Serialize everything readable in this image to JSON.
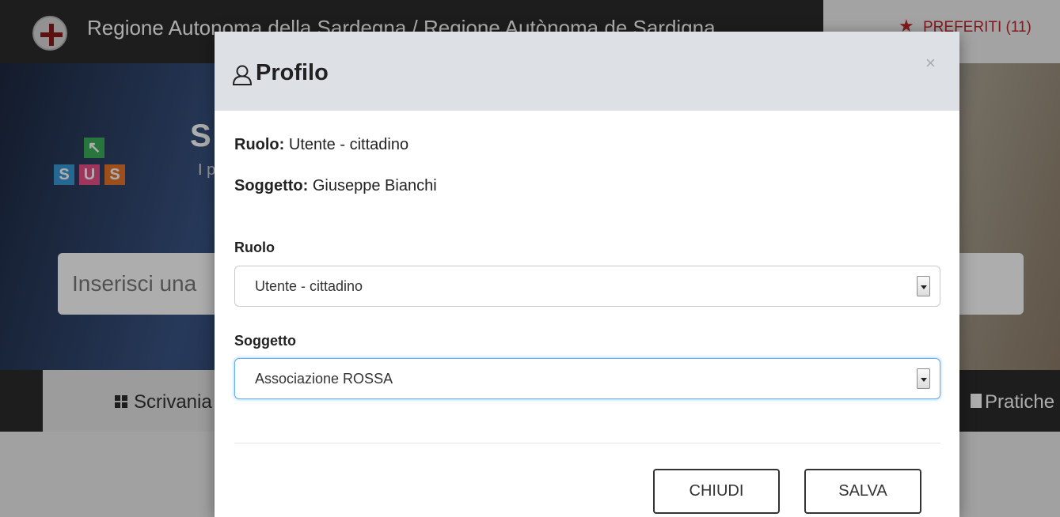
{
  "header": {
    "region_title": "Regione Autonoma della Sardegna / Regione Autònoma de Sardigna",
    "favorites_label": "PREFERITI (11)"
  },
  "hero": {
    "logo_letters": [
      "S",
      "U",
      "S"
    ],
    "title": "S",
    "subtitle": "I p",
    "search_placeholder": "Inserisci una"
  },
  "tabs": {
    "desk_label": "Scrivania",
    "practices_label": "Pratiche"
  },
  "modal": {
    "title": "Profilo",
    "close_symbol": "×",
    "info": {
      "role_label": "Ruolo:",
      "role_value": "Utente - cittadino",
      "subject_label": "Soggetto:",
      "subject_value": "Giuseppe Bianchi"
    },
    "fields": {
      "role_label": "Ruolo",
      "role_selected": "Utente - cittadino",
      "subject_label": "Soggetto",
      "subject_selected": "Associazione ROSSA"
    },
    "buttons": {
      "close": "CHIUDI",
      "save": "SALVA"
    }
  },
  "colors": {
    "accent_red": "#c0262d",
    "focus_blue": "#66afe9",
    "header_gray": "#dde1e6"
  },
  "icons": [
    "crest-icon",
    "star-icon",
    "grid-icon",
    "document-icon",
    "user-icon",
    "close-icon",
    "chevron-down-icon"
  ]
}
